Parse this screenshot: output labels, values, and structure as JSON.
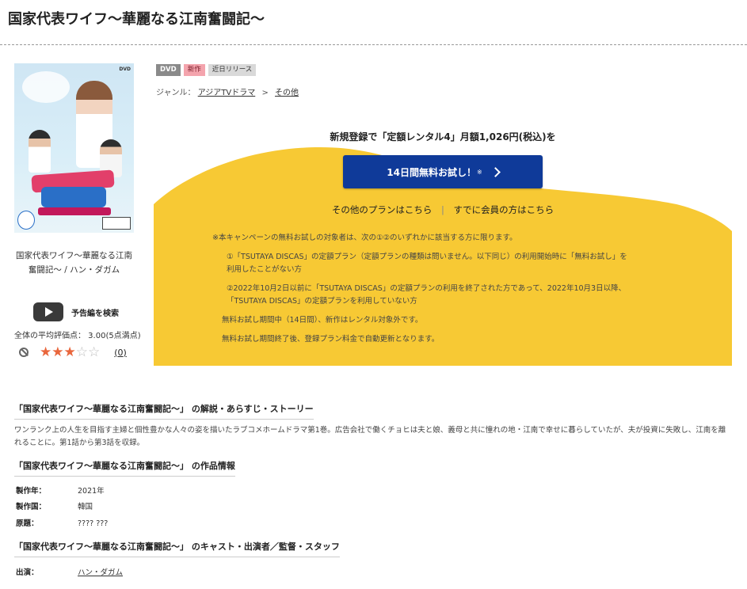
{
  "page": {
    "title": "国家代表ワイフ〜華麗なる江南奮闘記〜"
  },
  "cover": {
    "caption": "国家代表ワイフ〜華麗なる江南奮闘記〜 / ハン・ダガム",
    "format_mark": "DVD"
  },
  "trailer": {
    "label": "予告編を検索"
  },
  "rating": {
    "average_text": "全体の平均評価点： 3.00(5点満点)",
    "stars_filled": 3,
    "stars_total": 5,
    "review_count": "(0)"
  },
  "tags": [
    "DVD",
    "新作",
    "近日リリース"
  ],
  "genre": {
    "label": "ジャンル：",
    "links": [
      "アジアTVドラマ",
      "その他"
    ],
    "separator": ">"
  },
  "campaign": {
    "headline": "新規登録で「定額レンタル4」月額1,026円(税込)を",
    "cta_label": "14日間無料お試し！",
    "cta_mark": "※",
    "other_plans": "その他のプランはこちら",
    "divider": "|",
    "member_login": "すでに会員の方はこちら",
    "background_color": "#f7c934",
    "cta_color": "#0f3a99",
    "notes": [
      "※本キャンペーンの無料お試しの対象者は、次の①②のいずれかに該当する方に限ります。",
      "①「TSUTAYA DISCAS」の定額プラン（定額プランの種類は問いません。以下同じ）の利用開始時に「無料お試し」を",
      "利用したことがない方",
      "②2022年10月2日以前に「TSUTAYA DISCAS」の定額プランの利用を終了された方であって、2022年10月3日以降、",
      "「TSUTAYA DISCAS」の定額プランを利用していない方",
      "無料お試し期間中（14日間）、新作はレンタル対象外です。",
      "無料お試し期間終了後、登録プラン料金で自動更新となります。"
    ]
  },
  "story": {
    "heading": "「国家代表ワイフ〜華麗なる江南奮闘記〜」 の解説・あらすじ・ストーリー",
    "text": "ワンランク上の人生を目指す主婦と個性豊かな人々の姿を描いたラブコメホームドラマ第1巻。広告会社で働くチョヒは夫と娘、義母と共に憧れの地・江南で幸せに暮らしていたが、夫が投資に失敗し、江南を離れることに。第1話から第3話を収録。"
  },
  "work_info": {
    "heading": "「国家代表ワイフ〜華麗なる江南奮闘記〜」 の作品情報",
    "rows": [
      {
        "key": "製作年：",
        "value": "2021年"
      },
      {
        "key": "製作国：",
        "value": "韓国"
      },
      {
        "key": "原題：",
        "value": "???? ???"
      }
    ]
  },
  "cast": {
    "heading": "「国家代表ワイフ〜華麗なる江南奮闘記〜」 のキャスト・出演者／監督・スタッフ",
    "rows": [
      {
        "key": "出演：",
        "value": "ハン・ダガム"
      }
    ]
  }
}
